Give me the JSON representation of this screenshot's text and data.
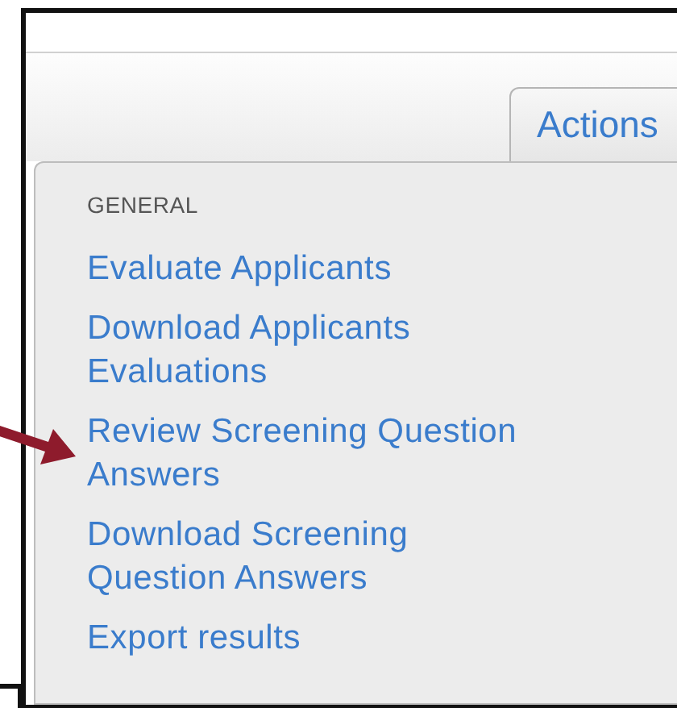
{
  "actions_button": {
    "label": "Actions"
  },
  "menu": {
    "heading": "GENERAL",
    "items": [
      {
        "lines": [
          "Evaluate Applicants"
        ]
      },
      {
        "lines": [
          "Download Applicants",
          "Evaluations"
        ]
      },
      {
        "lines": [
          "Review Screening Question",
          "Answers"
        ]
      },
      {
        "lines": [
          "Download Screening",
          "Question Answers"
        ]
      },
      {
        "lines": [
          "Export results"
        ]
      }
    ]
  }
}
